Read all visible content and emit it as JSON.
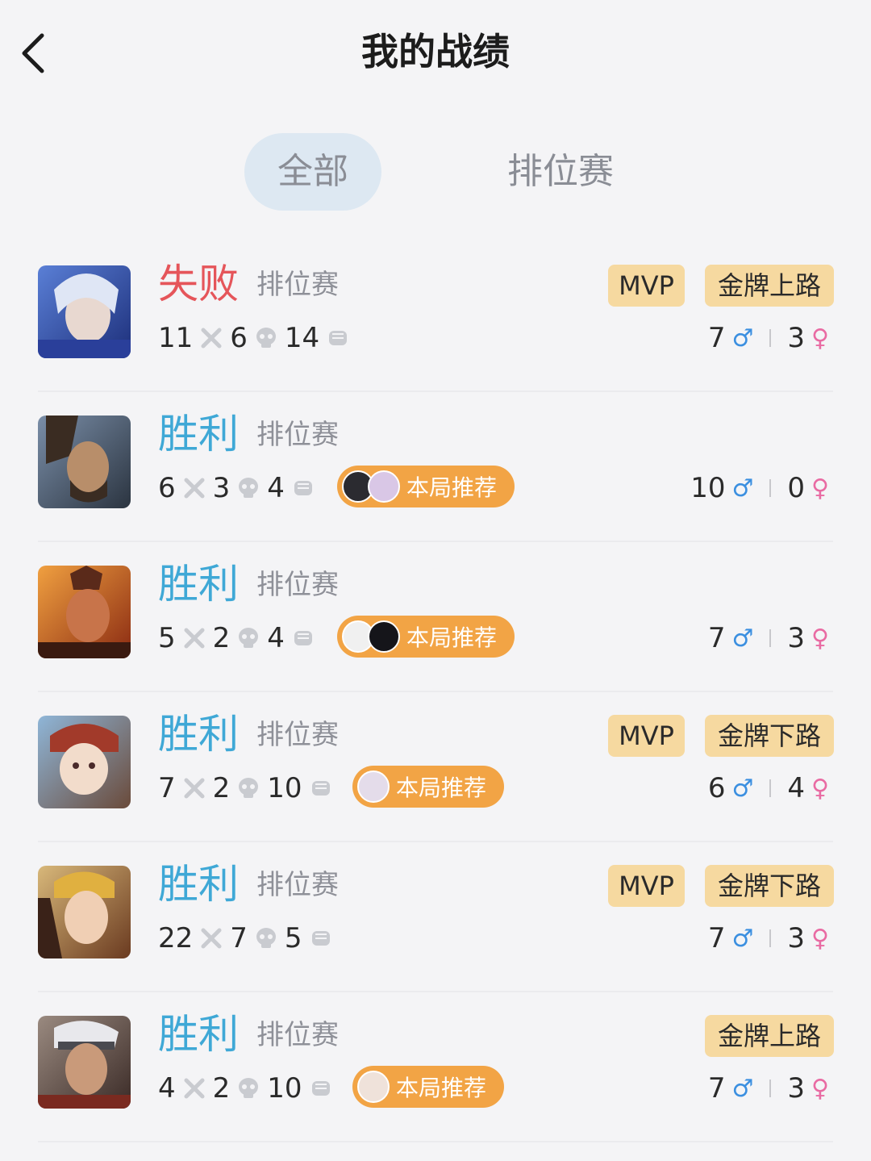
{
  "header": {
    "title": "我的战绩",
    "back_icon": "chevron-left-icon"
  },
  "tabs": [
    {
      "label": "全部",
      "active": true
    },
    {
      "label": "排位赛",
      "active": false
    }
  ],
  "matches": [
    {
      "result": "失败",
      "outcome": "loss",
      "mode": "排位赛",
      "kills": "11",
      "deaths": "6",
      "assists": "14",
      "badges": {
        "mvp": "MVP",
        "role": "金牌上路"
      },
      "recommend": null,
      "male_count": "7",
      "female_count": "3"
    },
    {
      "result": "胜利",
      "outcome": "win",
      "mode": "排位赛",
      "kills": "6",
      "deaths": "3",
      "assists": "4",
      "badges": null,
      "recommend": "本局推荐",
      "male_count": "10",
      "female_count": "0"
    },
    {
      "result": "胜利",
      "outcome": "win",
      "mode": "排位赛",
      "kills": "5",
      "deaths": "2",
      "assists": "4",
      "badges": null,
      "recommend": "本局推荐",
      "male_count": "7",
      "female_count": "3"
    },
    {
      "result": "胜利",
      "outcome": "win",
      "mode": "排位赛",
      "kills": "7",
      "deaths": "2",
      "assists": "10",
      "badges": {
        "mvp": "MVP",
        "role": "金牌下路"
      },
      "recommend": "本局推荐",
      "male_count": "6",
      "female_count": "4"
    },
    {
      "result": "胜利",
      "outcome": "win",
      "mode": "排位赛",
      "kills": "22",
      "deaths": "7",
      "assists": "5",
      "badges": {
        "mvp": "MVP",
        "role": "金牌下路"
      },
      "recommend": null,
      "male_count": "7",
      "female_count": "3"
    },
    {
      "result": "胜利",
      "outcome": "win",
      "mode": "排位赛",
      "kills": "4",
      "deaths": "2",
      "assists": "10",
      "badges": {
        "mvp": null,
        "role": "金牌上路"
      },
      "recommend": "本局推荐",
      "male_count": "7",
      "female_count": "3"
    }
  ],
  "symbols": {
    "male": "♂",
    "female": "♀"
  },
  "colors": {
    "win": "#3fa8d6",
    "loss": "#e5555a",
    "badge": "#f6d9a0",
    "recommend": "#f2a445",
    "male": "#3b8fe0",
    "female": "#e96ba3"
  }
}
